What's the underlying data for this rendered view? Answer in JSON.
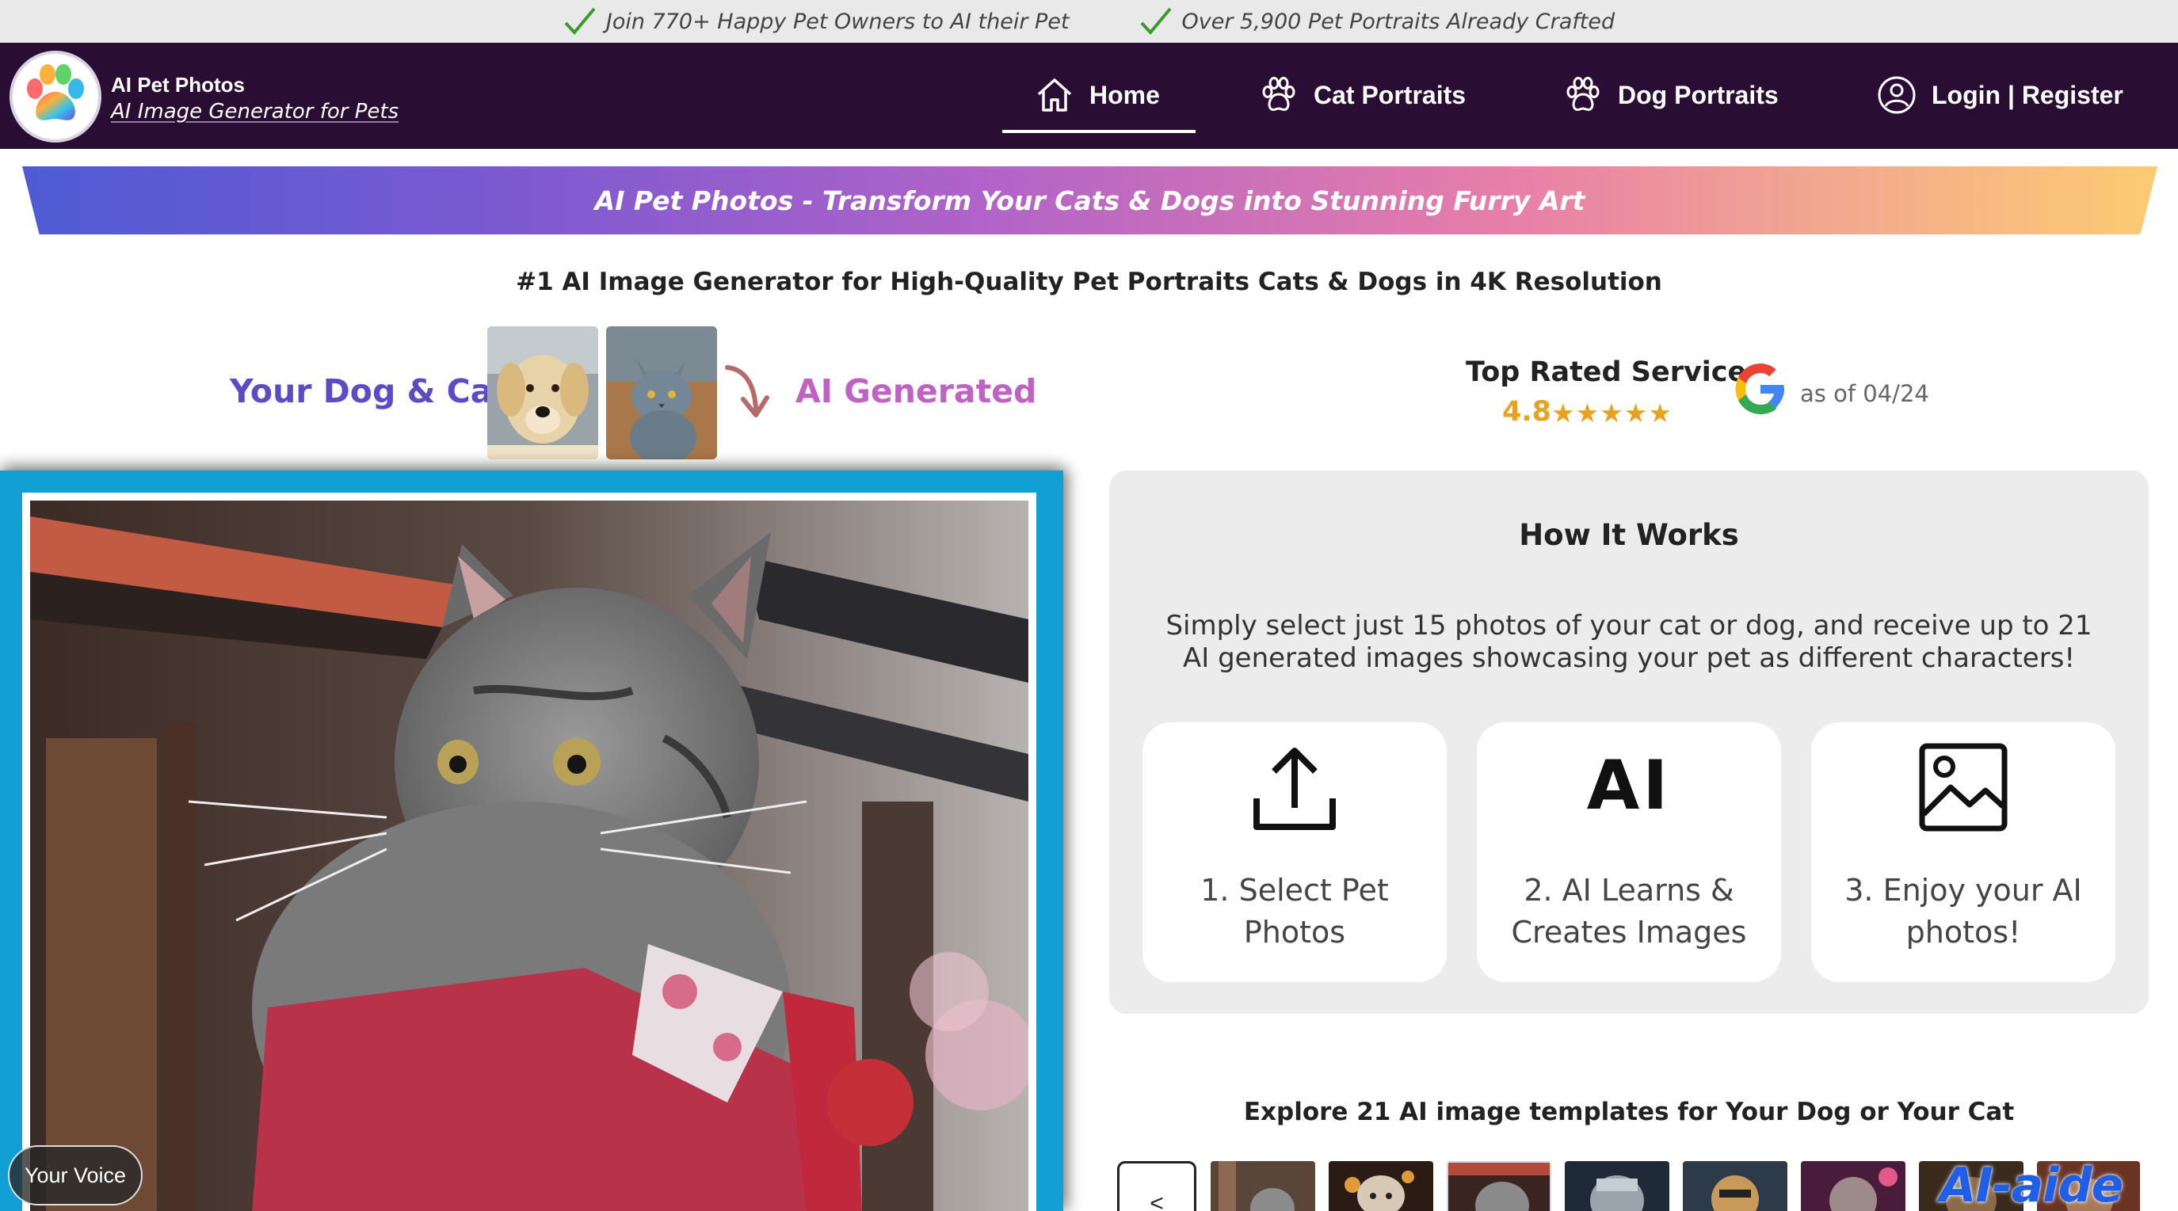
{
  "promo": {
    "item1": "Join 770+ Happy Pet Owners to AI their Pet",
    "item2": "Over 5,900 Pet Portraits Already Crafted"
  },
  "brand": {
    "name": "AI Pet Photos",
    "tagline": "AI Image Generator for Pets"
  },
  "nav": {
    "home": "Home",
    "cat": "Cat Portraits",
    "dog": "Dog Portraits",
    "login": "Login | Register"
  },
  "banner": "AI Pet Photos - Transform Your Cats & Dogs into Stunning Furry Art",
  "subheadline": "#1 AI Image Generator for High-Quality Pet Portraits Cats & Dogs in 4K Resolution",
  "compare": {
    "before_label": "Your Dog & Cat",
    "after_label": "AI Generated"
  },
  "rating": {
    "title": "Top Rated Service",
    "score": "4.8",
    "stars": "★★★★★",
    "date": "as of 04/24"
  },
  "how": {
    "title": "How It Works",
    "description": "Simply select just 15 photos of your cat or dog, and receive up to 21 AI generated images showcasing your pet as different characters!",
    "steps": [
      {
        "label_line1": "1. Select Pet",
        "label_line2": "Photos",
        "icon": "upload-icon"
      },
      {
        "label_line1": "2. AI Learns &",
        "label_line2": "Creates Images",
        "icon": "ai-icon",
        "glyph": "AI"
      },
      {
        "label_line1": "3. Enjoy your AI",
        "label_line2": "photos!",
        "icon": "image-icon"
      }
    ]
  },
  "explore": {
    "title": "Explore 21 AI image templates for Your Dog or Your Cat",
    "prev": "<"
  },
  "voice_button": "Your Voice",
  "watermark": "AI-aide",
  "colors": {
    "navbar": "#2a0d33",
    "promo_bg": "#e9e9e9",
    "frame": "#12a0d4",
    "before_label": "#5b4cc6",
    "after_label": "#c061c4",
    "rating": "#e9a21f"
  }
}
